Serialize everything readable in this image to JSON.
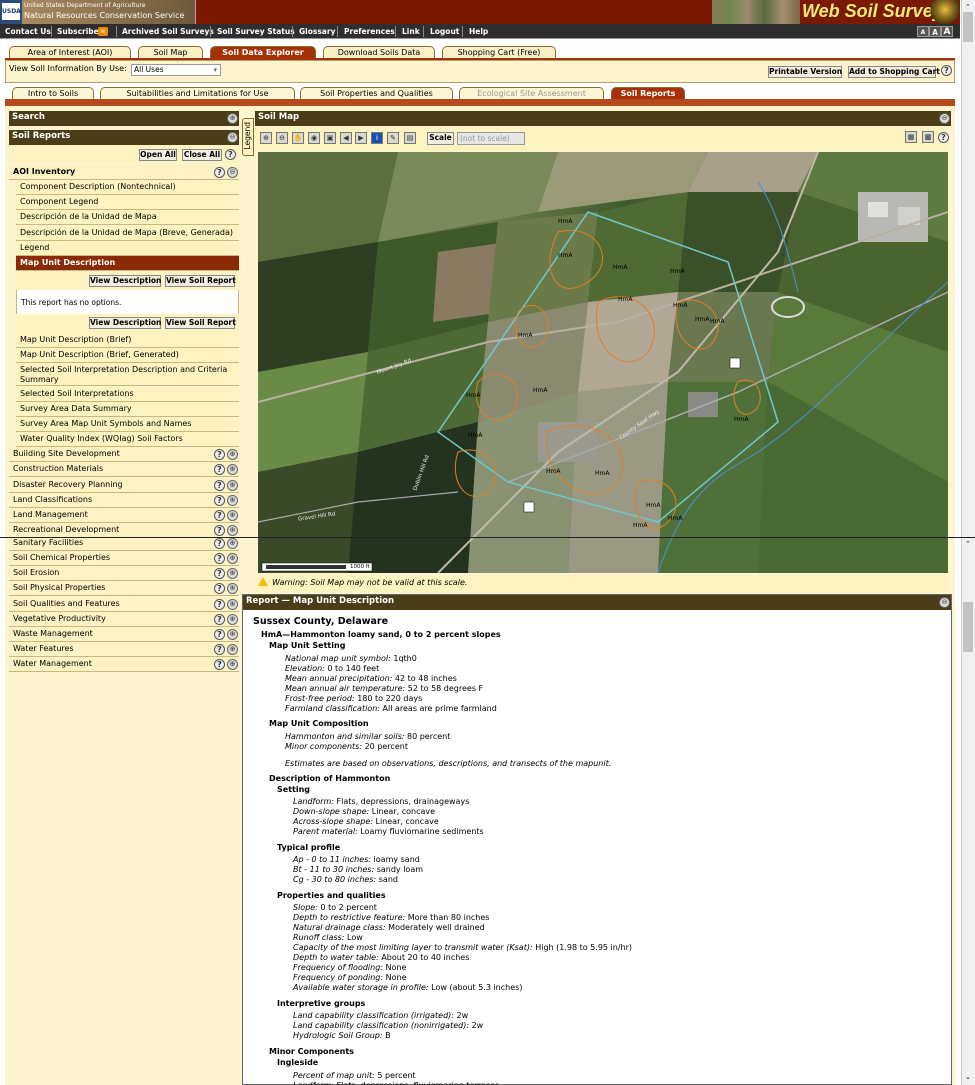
{
  "header": {
    "usda_line1": "United States Department of Agriculture",
    "usda_line2": "Natural Resources Conservation Service",
    "usda_mark": "USDA",
    "app_title": "Web Soil Survey"
  },
  "menu": {
    "items": [
      "Contact Us",
      "Subscribe",
      "Archived Soil Surveys",
      "Soil Survey Status",
      "Glossary",
      "Preferences",
      "Link",
      "Logout",
      "Help"
    ],
    "font_sizes": [
      "A",
      "A",
      "A"
    ]
  },
  "top_tabs": [
    "Area of Interest (AOI)",
    "Soil Map",
    "Soil Data Explorer",
    "Download Soils Data",
    "Shopping Cart (Free)"
  ],
  "info_bar": {
    "label": "View Soil Information By Use:",
    "select_value": "All Uses",
    "printable": "Printable Version",
    "add_cart": "Add to Shopping Cart",
    "help": "?"
  },
  "sub_tabs": [
    "Intro to Soils",
    "Suitabilities and Limitations for Use",
    "Soil Properties and Qualities",
    "Ecological Site Assessment",
    "Soil Reports"
  ],
  "left": {
    "search_title": "Search",
    "soil_reports_title": "Soil Reports",
    "open_all": "Open All",
    "close_all": "Close All",
    "aoi_inventory": "AOI Inventory",
    "aoi_items_top": [
      "Component Description (Nontechnical)",
      "Component Legend",
      "Descripción de la Unidad de Mapa",
      "Descripción de la Unidad de Mapa (Breve, Generada)",
      "Legend"
    ],
    "selected": "Map Unit Description",
    "view_description": "View Description",
    "view_soil_report": "View Soil Report",
    "no_options": "This report has no options.",
    "aoi_items_bottom": [
      "Map Unit Description (Brief)",
      "Map Unit Description (Brief, Generated)",
      "Selected Soil Interpretation Description and Criteria Summary",
      "Selected Soil Interpretations",
      "Survey Area Data Summary",
      "Survey Area Map Unit Symbols and Names",
      "Water Quality Index (WQIag) Soil Factors"
    ],
    "categories": [
      "Building Site Development",
      "Construction Materials",
      "Disaster Recovery Planning",
      "Land Classifications",
      "Land Management",
      "Recreational Development",
      "Sanitary Facilities",
      "Soil Chemical Properties",
      "Soil Erosion",
      "Soil Physical Properties",
      "Soil Qualities and Features",
      "Vegetative Productivity",
      "Waste Management",
      "Water Features",
      "Water Management"
    ]
  },
  "map": {
    "title": "Soil Map",
    "legend_tab": "Legend",
    "scale_button": "Scale",
    "scale_value": "(not to scale)",
    "scale_bar_label": "1000 ft",
    "warning": "Warning: Soil Map may not be valid at this scale.",
    "labels": [
      "HmA",
      "HmA",
      "HmA",
      "HmA",
      "HmA",
      "HmA",
      "HmA",
      "HmA",
      "HmA",
      "HmA",
      "HmA",
      "HmA",
      "HmA",
      "HmA",
      "HmA",
      "HmA",
      "HmA",
      "HmA"
    ],
    "road_labels": [
      "Mount Joy Rd",
      "County Seat Hwy",
      "Gravel Hill Rd",
      "Dublin Hill Rd"
    ]
  },
  "report": {
    "title": "Report — Map Unit Description",
    "county": "Sussex County, Delaware",
    "map_unit": "HmA—Hammonton loamy sand, 0 to 2 percent slopes",
    "setting_head": "Map Unit Setting",
    "setting": [
      [
        "National map unit symbol:",
        " 1qth0"
      ],
      [
        "Elevation:",
        " 0 to 140 feet"
      ],
      [
        "Mean annual precipitation:",
        " 42 to 48 inches"
      ],
      [
        "Mean annual air temperature:",
        " 52 to 58 degrees F"
      ],
      [
        "Frost-free period:",
        " 180 to 220 days"
      ],
      [
        "Farmland classification:",
        " All areas are prime farmland"
      ]
    ],
    "composition_head": "Map Unit Composition",
    "composition": [
      [
        "Hammonton and similar soils:",
        " 80 percent"
      ],
      [
        "Minor components:",
        " 20 percent"
      ]
    ],
    "estimates": "Estimates are based on observations, descriptions, and transects of the mapunit.",
    "desc_head": "Description of Hammonton",
    "setting2_head": "Setting",
    "setting2": [
      [
        "Landform:",
        " Flats, depressions, drainageways"
      ],
      [
        "Down-slope shape:",
        " Linear, concave"
      ],
      [
        "Across-slope shape:",
        " Linear, concave"
      ],
      [
        "Parent material:",
        " Loamy fluviomarine sediments"
      ]
    ],
    "profile_head": "Typical profile",
    "profile": [
      [
        "Ap - 0 to 11 inches:",
        " loamy sand"
      ],
      [
        "Bt - 11 to 30 inches:",
        " sandy loam"
      ],
      [
        "Cg - 30 to 80 inches:",
        " sand"
      ]
    ],
    "props_head": "Properties and qualities",
    "props": [
      [
        "Slope:",
        " 0 to 2 percent"
      ],
      [
        "Depth to restrictive feature:",
        " More than 80 inches"
      ],
      [
        "Natural drainage class:",
        " Moderately well drained"
      ],
      [
        "Runoff class:",
        " Low"
      ],
      [
        "Capacity of the most limiting layer to transmit water (Ksat):",
        " High (1.98 to 5.95 in/hr)"
      ],
      [
        "Depth to water table:",
        " About 20 to 40 inches"
      ],
      [
        "Frequency of flooding:",
        " None"
      ],
      [
        "Frequency of ponding:",
        " None"
      ],
      [
        "Available water storage in profile:",
        " Low (about 5.3 inches)"
      ]
    ],
    "interp_head": "Interpretive groups",
    "interp": [
      [
        "Land capability classification (irrigated):",
        " 2w"
      ],
      [
        "Land capability classification (nonirrigated):",
        " 2w"
      ],
      [
        "Hydrologic Soil Group:",
        " B"
      ]
    ],
    "minor_head": "Minor Components",
    "ingleside": "Ingleside",
    "minor": [
      [
        "Percent of map unit:",
        " 5 percent"
      ],
      [
        "Landform:",
        " Flats, depressions, fluviomarine terraces"
      ]
    ]
  }
}
